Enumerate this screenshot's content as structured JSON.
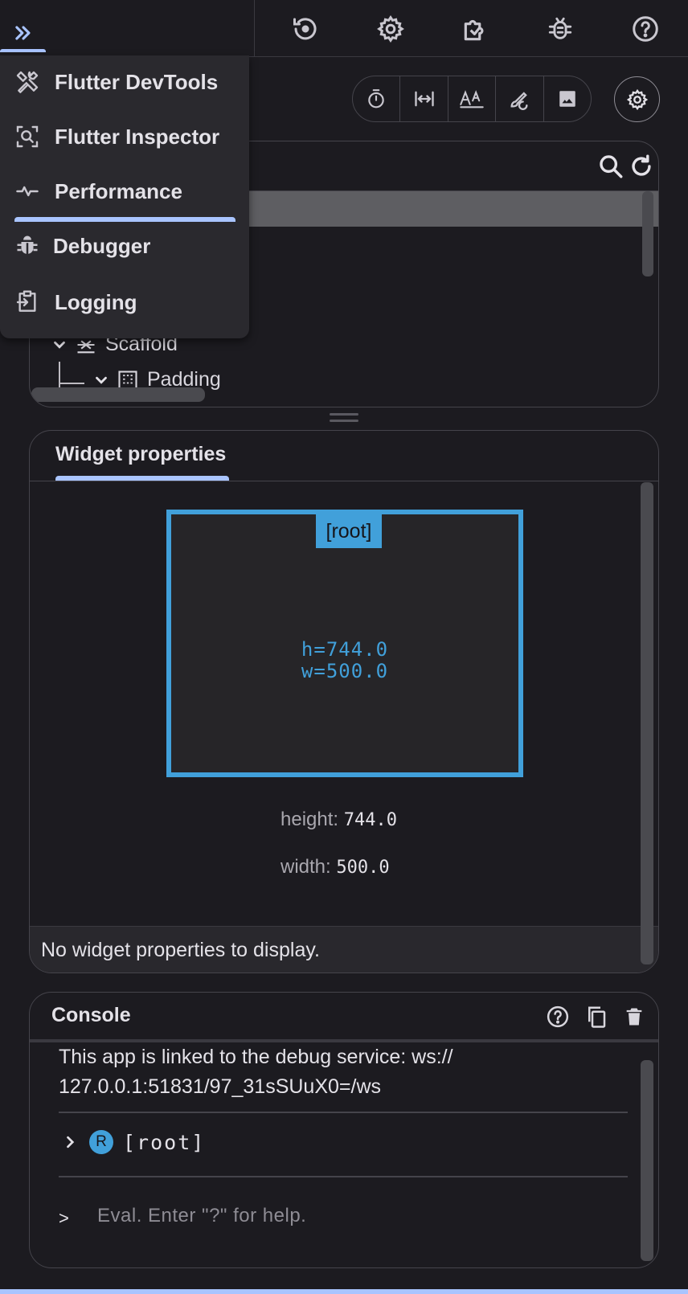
{
  "colors": {
    "accent": "#a9c4ff",
    "root_blue": "#41a0da",
    "background": "#1c1b20"
  },
  "topbar": {
    "expand_icon": "double-chevron-right-icon",
    "icons": [
      "history-icon",
      "settings-gear-icon",
      "extension-icon",
      "bug-icon",
      "help-icon"
    ]
  },
  "menu": {
    "items": [
      {
        "label": "Flutter DevTools",
        "icon": "tools-icon"
      },
      {
        "label": "Flutter Inspector",
        "icon": "inspector-icon",
        "selected": true
      },
      {
        "label": "Performance",
        "icon": "pulse-icon"
      },
      {
        "label": "Debugger",
        "icon": "bug-icon"
      },
      {
        "label": "Logging",
        "icon": "logging-icon"
      }
    ]
  },
  "toolbar": {
    "buttons": [
      "timer-icon",
      "width-icon",
      "text-size-icon",
      "repaint-icon",
      "image-icon"
    ],
    "settings_icon": "settings-gear-icon"
  },
  "tree": {
    "rows": [
      {
        "label": "Scaffold",
        "icon": "scaffold-icon"
      },
      {
        "label": "Padding",
        "icon": "padding-icon"
      }
    ]
  },
  "properties": {
    "tab_label": "Widget properties",
    "root_tag": "[root]",
    "height_dim": "h=744.0",
    "width_dim": "w=500.0",
    "height_label": "height:",
    "height_value": "744.0",
    "width_label": "width:",
    "width_value": "500.0",
    "empty_message": "No widget properties to display."
  },
  "console": {
    "title": "Console",
    "message_line1": "This app is linked to the debug service: ws://",
    "message_line2": "127.0.0.1:51831/97_31sSUuX0=/ws",
    "root_badge": "R",
    "root_label": "[root]",
    "prompt": ">",
    "eval_placeholder": "Eval. Enter \"?\" for help."
  }
}
